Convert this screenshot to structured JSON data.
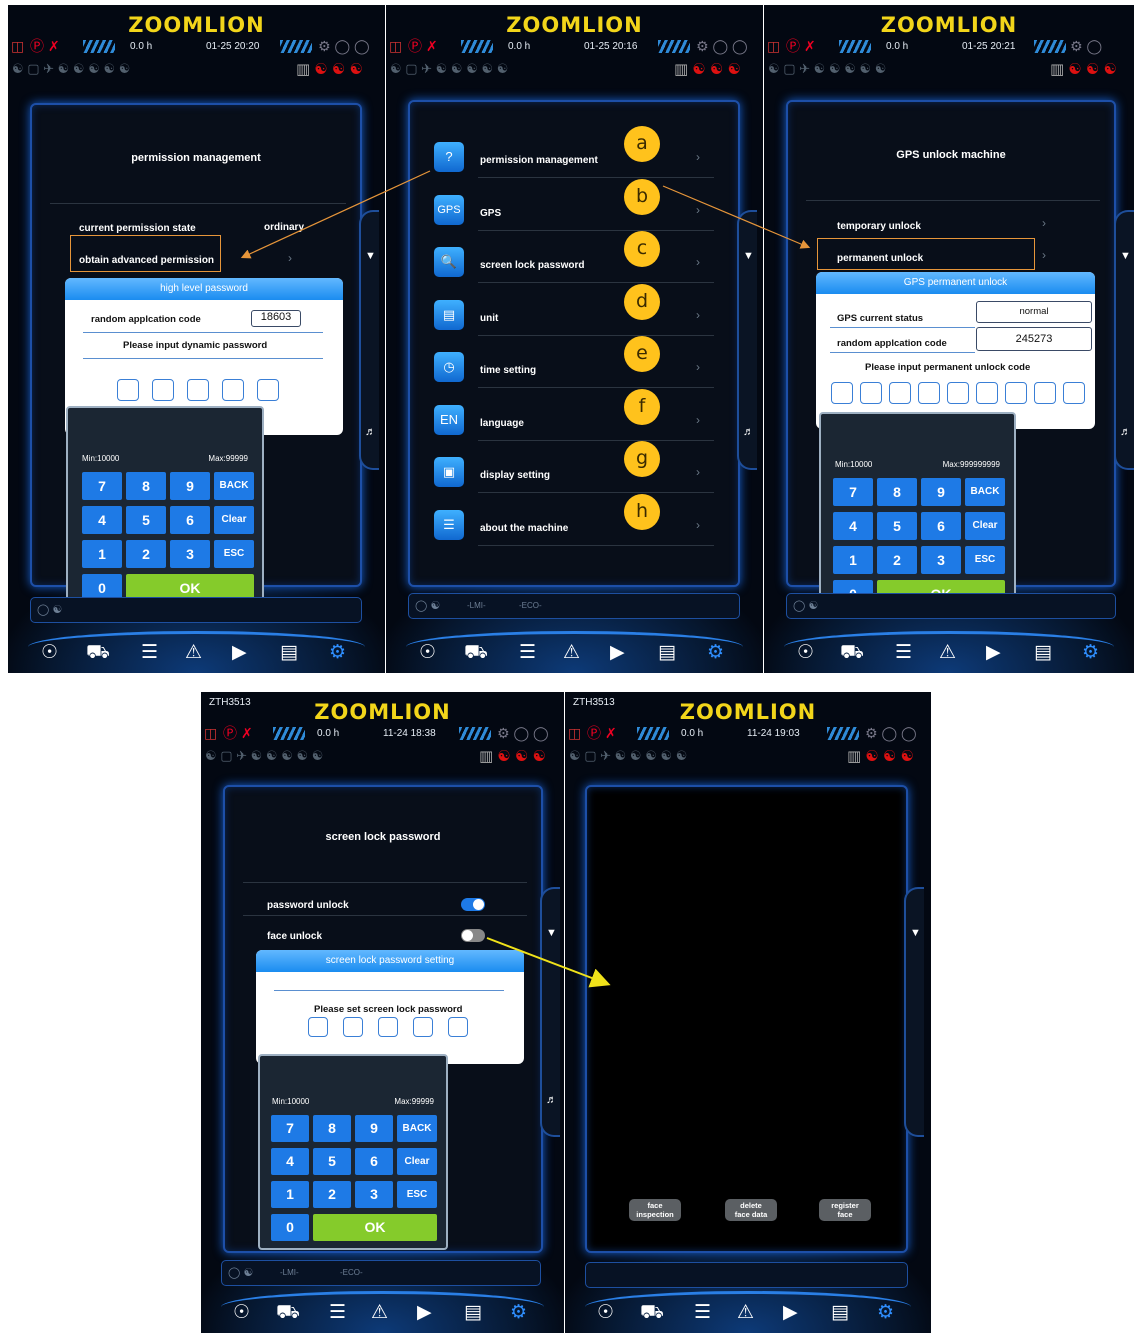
{
  "brand": "ZOOMLION",
  "header_icons": {
    "battery": "battery-icon",
    "park": "parking-brake-icon",
    "stripes": "signal-stripes-icon",
    "hours": "engine-hours-icon",
    "temps": "warning-lamps-icon",
    "fuel": "fuel-icon",
    "red": "red-warning-icons"
  },
  "s1": {
    "hours": "0.0 h",
    "datetime": "01-25 20:20",
    "title": "permission management",
    "state_label": "current permission state",
    "state_value": "ordinary",
    "adv_label": "obtain advanced permission",
    "dialog": {
      "title": "high level password",
      "code_label": "random applcation code",
      "code_value": "18603",
      "prompt": "Please input dynamic password"
    },
    "keypad": {
      "min": "Min:10000",
      "max": "Max:99999"
    }
  },
  "s2": {
    "hours": "0.0 h",
    "datetime": "01-25 20:16",
    "items": [
      {
        "icon": "?",
        "label": "permission management",
        "badge": "a"
      },
      {
        "icon": "GPS",
        "label": "GPS",
        "badge": "b"
      },
      {
        "icon": "&#9906;",
        "label": "screen lock password",
        "badge": "c"
      },
      {
        "icon": "",
        "label": "unit",
        "badge": "d"
      },
      {
        "icon": "",
        "label": "time setting",
        "badge": "e"
      },
      {
        "icon": "EN",
        "label": "language",
        "badge": "f"
      },
      {
        "icon": "",
        "label": "display setting",
        "badge": "g"
      },
      {
        "icon": "",
        "label": "about the machine",
        "badge": "h"
      }
    ]
  },
  "s3": {
    "hours": "0.0 h",
    "datetime": "01-25 20:21",
    "title": "GPS unlock machine",
    "temp_label": "temporary unlock",
    "perm_label": "permanent unlock",
    "dialog": {
      "title": "GPS permanent unlock",
      "status_label": "GPS current status",
      "status_value": "normal",
      "code_label": "random applcation code",
      "code_value": "245273",
      "prompt": "Please input permanent unlock code"
    },
    "keypad": {
      "min": "Min:10000",
      "max": "Max:999999999"
    }
  },
  "s4": {
    "model": "ZTH3513",
    "hours": "0.0 h",
    "datetime": "11-24 18:38",
    "title": "screen lock password",
    "pw_label": "password unlock",
    "face_label": "face unlock",
    "pw_on": true,
    "face_on": false,
    "dialog": {
      "title": "screen lock password setting",
      "prompt": "Please set screen lock password"
    },
    "keypad": {
      "min": "Min:10000",
      "max": "Max:99999"
    }
  },
  "s5": {
    "model": "ZTH3513",
    "hours": "0.0 h",
    "datetime": "11-24 19:03",
    "buttons": [
      {
        "l1": "face",
        "l2": "inspection"
      },
      {
        "l1": "delete",
        "l2": "face data"
      },
      {
        "l1": "register",
        "l2": "face"
      }
    ]
  },
  "keys": {
    "k7": "7",
    "k8": "8",
    "k9": "9",
    "back": "BACK",
    "k4": "4",
    "k5": "5",
    "k6": "6",
    "clear": "Clear",
    "k1": "1",
    "k2": "2",
    "k3": "3",
    "esc": "ESC",
    "k0": "0",
    "ok": "OK"
  },
  "bottom_bar": {
    "lmi": "-LMI-",
    "eco": "-ECO-"
  },
  "colors": {
    "accent": "#1e7ae6",
    "ok": "#85cb2b",
    "brand": "#f2d51a",
    "badge": "#ffc21c",
    "annotation_orange": "#e6953a",
    "annotation_yellow": "#f0e21a"
  }
}
